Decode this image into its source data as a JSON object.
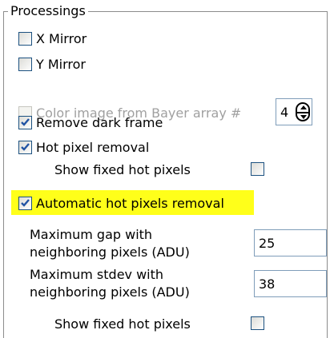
{
  "group": {
    "title": "Processings"
  },
  "options": {
    "x_mirror": {
      "label": "X Mirror",
      "checked": false
    },
    "y_mirror": {
      "label": "Y Mirror",
      "checked": false
    },
    "bayer": {
      "label": "Color image from Bayer array #",
      "checked": false,
      "enabled": false,
      "value": "4"
    },
    "remove_dark": {
      "label": "Remove dark frame",
      "checked": true
    },
    "hot_pixel": {
      "label": "Hot pixel removal",
      "checked": true
    },
    "show_fixed_1": {
      "label": "Show fixed hot pixels",
      "checked": false
    },
    "auto_hot": {
      "label": "Automatic hot pixels removal",
      "checked": true,
      "highlight_color": "#ffff1a"
    },
    "max_gap": {
      "label_line1": "Maximum gap with",
      "label_line2": "neighboring pixels (ADU)",
      "value": "25"
    },
    "max_stdev": {
      "label_line1": "Maximum stdev with",
      "label_line2": "neighboring pixels (ADU)",
      "value": "38"
    },
    "show_fixed_2": {
      "label": "Show fixed hot pixels",
      "checked": false
    }
  },
  "colors": {
    "checkmark": "#2153a3",
    "border": "#7f9db9"
  },
  "icons": {
    "check": "checkmark-icon",
    "spin_up": "arrow-up-icon",
    "spin_down": "arrow-down-icon"
  }
}
